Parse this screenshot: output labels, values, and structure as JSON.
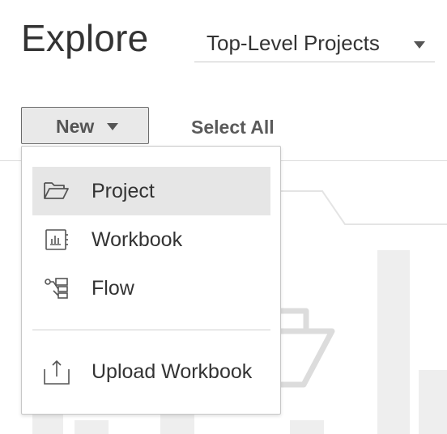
{
  "header": {
    "title": "Explore",
    "scope_select": {
      "value": "Top-Level Projects",
      "icon": "chevron-down-icon"
    }
  },
  "toolbar": {
    "new_label": "New",
    "new_icon": "chevron-down-icon",
    "select_all_label": "Select All"
  },
  "new_menu": {
    "items": [
      {
        "label": "Project",
        "icon": "folder-open-icon",
        "highlighted": true
      },
      {
        "label": "Workbook",
        "icon": "workbook-icon",
        "highlighted": false
      },
      {
        "label": "Flow",
        "icon": "flow-icon",
        "highlighted": false
      },
      {
        "label": "Upload Workbook",
        "icon": "upload-icon",
        "highlighted": false
      }
    ]
  },
  "colors": {
    "text": "#333333",
    "button_bg": "#e9e9e9",
    "highlight_bg": "#e6e6e6",
    "border": "#c7c7c7",
    "illustration": "#eeeeee"
  }
}
